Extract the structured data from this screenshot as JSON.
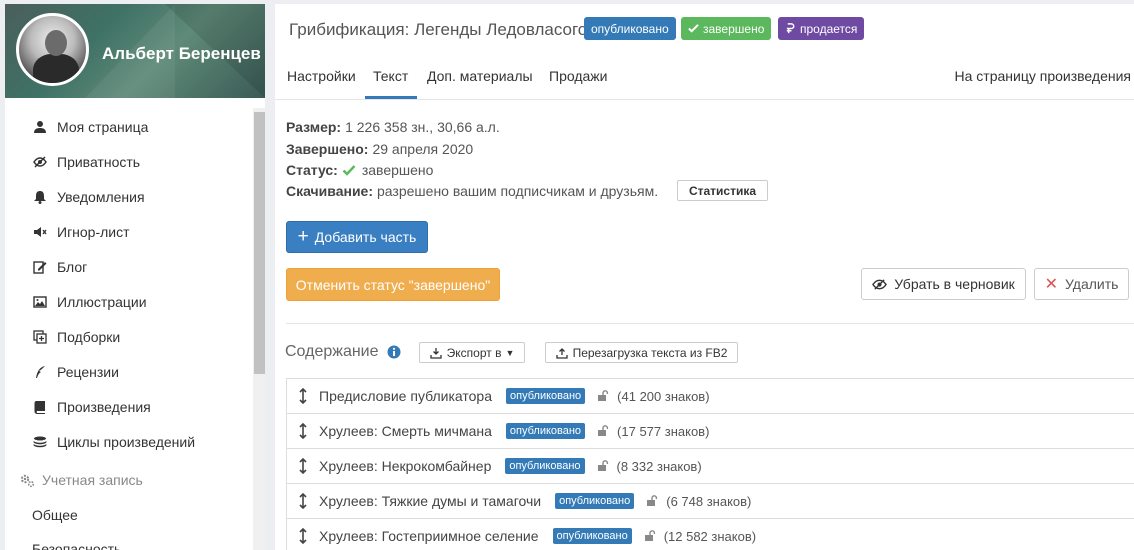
{
  "profile": {
    "name": "Альберт Беренцев"
  },
  "sidebar": {
    "items": [
      {
        "label": "Моя страница",
        "icon": "user-icon"
      },
      {
        "label": "Приватность",
        "icon": "eye-slash-icon"
      },
      {
        "label": "Уведомления",
        "icon": "bell-icon"
      },
      {
        "label": "Игнор-лист",
        "icon": "volume-off-icon"
      },
      {
        "label": "Блог",
        "icon": "edit-icon"
      },
      {
        "label": "Иллюстрации",
        "icon": "image-icon"
      },
      {
        "label": "Подборки",
        "icon": "collection-icon"
      },
      {
        "label": "Рецензии",
        "icon": "quill-icon"
      },
      {
        "label": "Произведения",
        "icon": "book-icon"
      },
      {
        "label": "Циклы произведений",
        "icon": "stack-icon"
      }
    ],
    "section": {
      "label": "Учетная запись",
      "icon": "gears-icon"
    },
    "sub_items": [
      "Общее",
      "Безопасность"
    ]
  },
  "work": {
    "title": "Грибификация: Легенды Ледовласого",
    "badges": {
      "published": "опубликовано",
      "completed": "завершено",
      "sale": "продается"
    }
  },
  "tabs": {
    "items": [
      "Настройки",
      "Текст",
      "Доп. материалы",
      "Продажи"
    ],
    "active": "Текст",
    "link": "На страницу произведения"
  },
  "info": {
    "size_label": "Размер:",
    "size_value": "1 226 358 зн., 30,66 а.л.",
    "completed_label": "Завершено:",
    "completed_value": "29 апреля 2020",
    "status_label": "Статус:",
    "status_value": "завершено",
    "download_label": "Скачивание:",
    "download_value": "разрешено вашим подписчикам и друзьям.",
    "stats_button": "Статистика"
  },
  "actions": {
    "add_part": "Добавить часть",
    "cancel_status": "Отменить статус \"завершено\"",
    "to_draft": "Убрать в черновик",
    "delete": "Удалить"
  },
  "contents": {
    "title": "Содержание",
    "export_button": "Экспорт в",
    "reload_button": "Перезагрузка текста из FB2",
    "parts": [
      {
        "title": "Предисловие публикатора",
        "status": "опубликовано",
        "chars": "(41 200 знаков)"
      },
      {
        "title": "Хрулеев: Смерть мичмана",
        "status": "опубликовано",
        "chars": "(17 577 знаков)"
      },
      {
        "title": "Хрулеев: Некрокомбайнер",
        "status": "опубликовано",
        "chars": "(8 332 знаков)"
      },
      {
        "title": "Хрулеев: Тяжкие думы и тамагочи",
        "status": "опубликовано",
        "chars": "(6 748 знаков)"
      },
      {
        "title": "Хрулеев: Гостеприимное селение",
        "status": "опубликовано",
        "chars": "(12 582 знаков)"
      }
    ]
  },
  "colors": {
    "primary": "#337ab7",
    "success": "#5cb85c",
    "warning": "#f0ad4e",
    "purple": "#6f4aa3",
    "danger": "#d9534f"
  }
}
